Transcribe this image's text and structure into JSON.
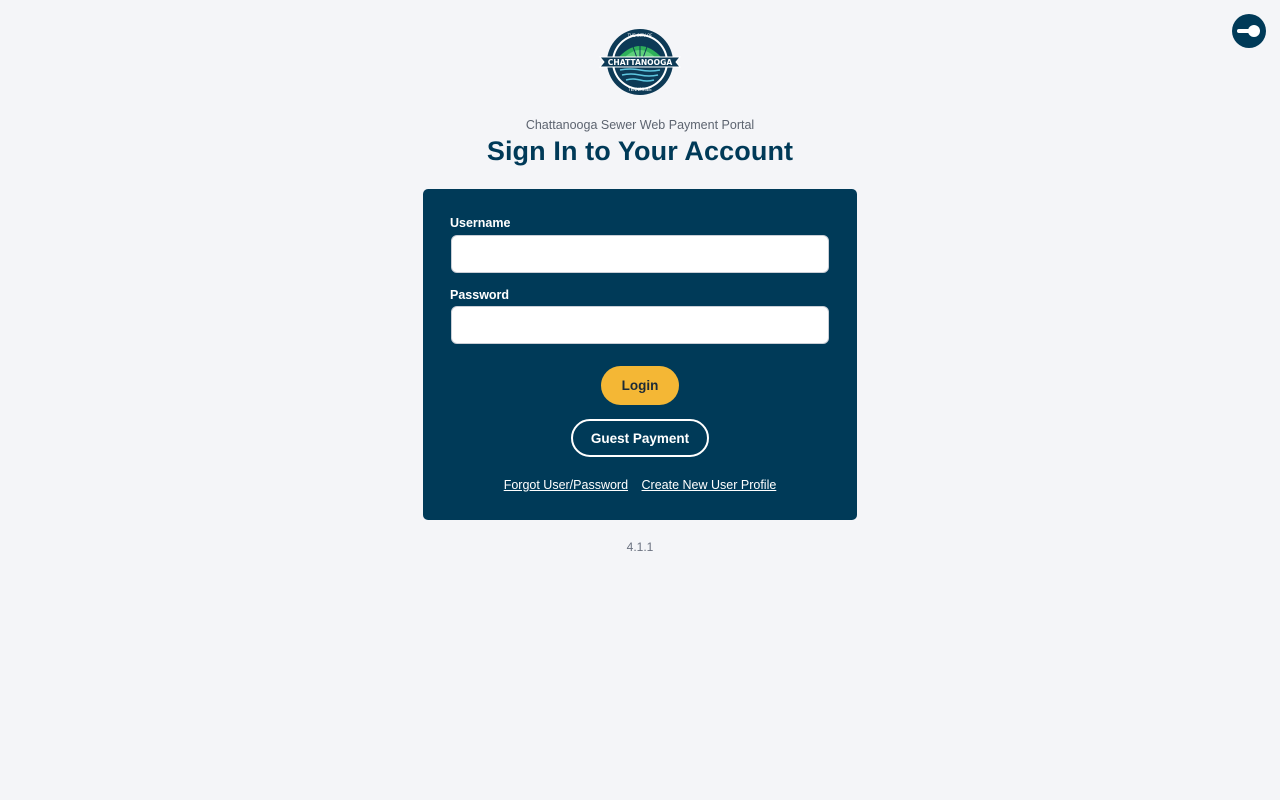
{
  "portal": {
    "subtitle": "Chattanooga Sewer Web Payment Portal",
    "title": "Sign In to Your Account",
    "logo_text": "CHATTANOOGA",
    "logo_top_text": "THE CITY OF",
    "logo_bottom_text": "TENNESSEE"
  },
  "form": {
    "username_label": "Username",
    "username_value": "",
    "password_label": "Password",
    "password_value": "",
    "login_label": "Login",
    "guest_label": "Guest Payment",
    "forgot_link": "Forgot User/Password",
    "create_link": "Create New User Profile"
  },
  "footer": {
    "version": "4.1.1"
  },
  "icons": {
    "corner": "key-icon"
  },
  "colors": {
    "brand_navy": "#003a58",
    "accent_gold": "#f4b735",
    "background": "#f4f5f8",
    "logo_green": "#2fb05a"
  }
}
